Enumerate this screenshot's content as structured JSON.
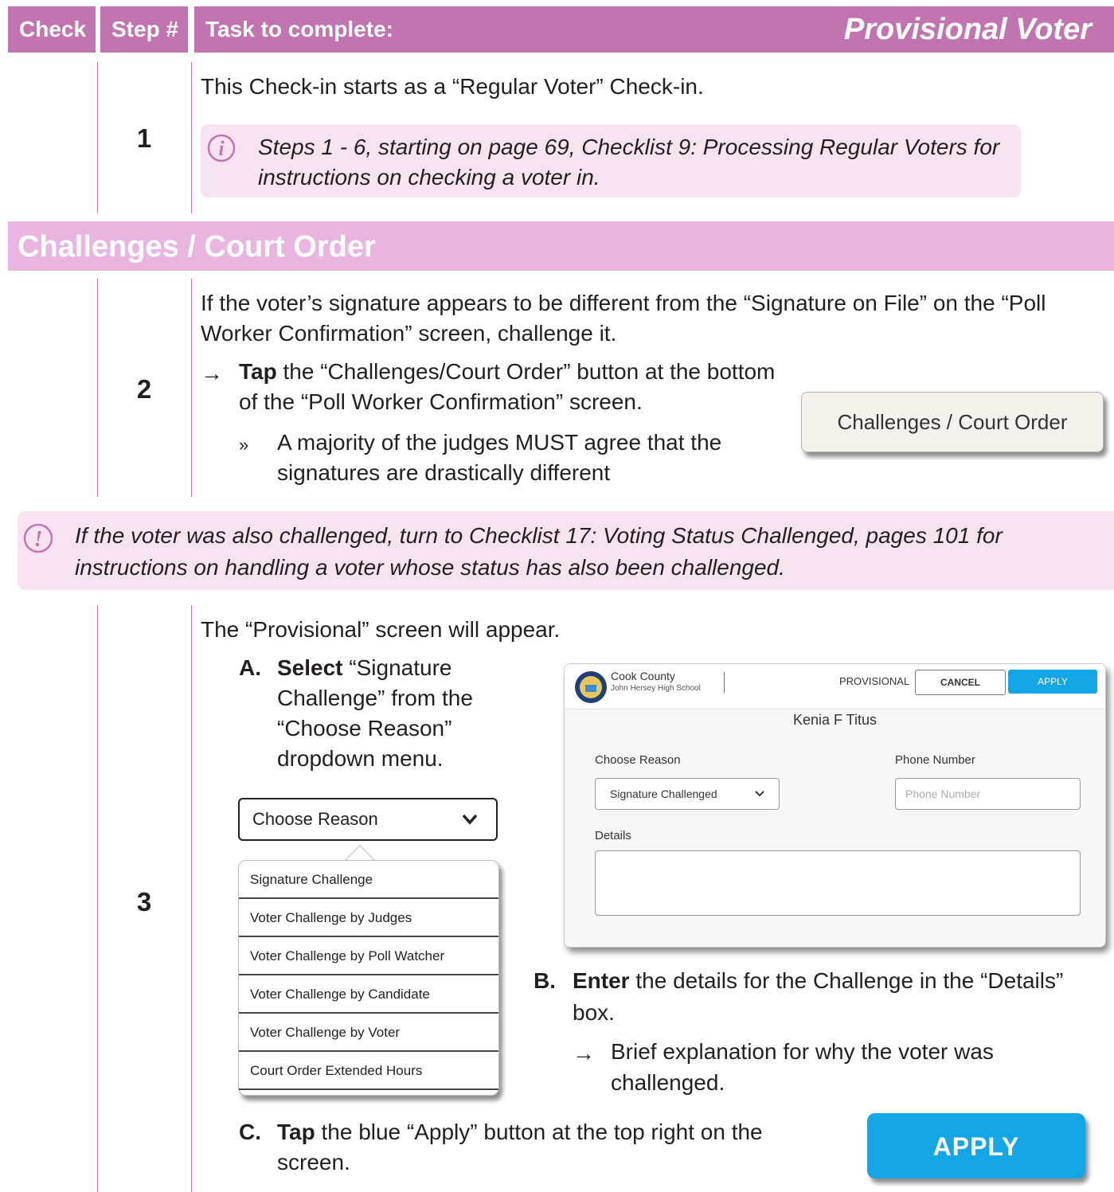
{
  "header": {
    "check": "Check",
    "step": "Step #",
    "task": "Task to complete:",
    "title": "Provisional Voter"
  },
  "step1": {
    "number": "1",
    "text": "This Check-in starts as a “Regular Voter” Check-in.",
    "info_line1": "Steps 1 - 6, starting on page 69, Checklist 9: Processing Regular Voters for",
    "info_line2": "instructions on checking a voter in."
  },
  "section": {
    "title": "Challenges / Court Order"
  },
  "step2": {
    "number": "2",
    "line1": "If the voter’s signature appears to be different from the “Signature on File” on the “Poll",
    "line2": "Worker Confirmation” screen, challenge it.",
    "arrow": "→",
    "tap": "Tap",
    "tap_rest1": "the “Challenges/Court Order” button at the bottom",
    "tap_rest2": "of the “Poll Worker Confirmation” screen.",
    "bullet": "»",
    "bullet_line1": "A majority of the judges MUST agree that the",
    "bullet_line2": "signatures are drastically different",
    "button_label": "Challenges / Court Order"
  },
  "warning": {
    "icon": "!",
    "line1": "If the voter was also challenged, turn to Checklist 17: Voting Status Challenged, pages 101  for",
    "line2": "instructions on handling a voter whose status has also been challenged."
  },
  "step3": {
    "number": "3",
    "intro": "The “Provisional” screen will appear.",
    "a_label": "A.",
    "a_bold": "Select",
    "a_line1": "“Signature",
    "a_line2": "Challenge” from the",
    "a_line3": "“Choose Reason”",
    "a_line4": "dropdown menu.",
    "dropdown_label": "Choose Reason",
    "dropdown_items": [
      "Signature Challenge",
      "Voter Challenge by Judges",
      "Voter Challenge by Poll Watcher",
      "Voter Challenge by Candidate",
      "Voter Challenge by Voter",
      "Court Order Extended Hours"
    ],
    "screen": {
      "org": "Cook County",
      "location": "John Hersey High School",
      "mode": "PROVISIONAL",
      "cancel": "CANCEL",
      "apply": "APPLY",
      "voter_name": "Kenia F Titus",
      "choose_reason_label": "Choose Reason",
      "choose_reason_value": "Signature Challenged",
      "phone_label": "Phone Number",
      "phone_placeholder": "Phone Number",
      "details_label": "Details"
    },
    "b_label": "B.",
    "b_bold": "Enter",
    "b_line1": "the details for the Challenge in the “Details”",
    "b_line2": "box.",
    "b_arrow": "→",
    "b_sub1": "Brief explanation for why the voter was",
    "b_sub2": "challenged.",
    "c_label": "C.",
    "c_bold": "Tap",
    "c_line1": "the blue “Apply” button at the top right on the",
    "c_line2": "screen.",
    "apply_button": "APPLY"
  },
  "colors": {
    "header": "#c274b0",
    "section": "#e9b4df",
    "infobox": "#f6e3ef",
    "apply": "#13a6e6"
  }
}
